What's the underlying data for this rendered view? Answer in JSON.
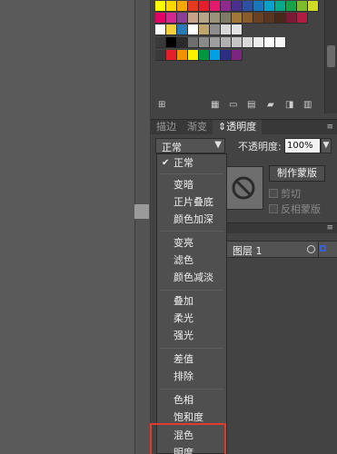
{
  "swatches": {
    "rows": [
      [
        "#fffc00",
        "#ffd800",
        "#f7a800",
        "#e63a1e",
        "#e41f2c",
        "#e31b6e",
        "#8e2a8e",
        "#4b2f8c",
        "#2f4fa0",
        "#1b75bb",
        "#0aa0c9",
        "#0aa88a",
        "#1aa24a",
        "#7dbd2d",
        "#cedb29"
      ],
      [
        "#e30065",
        "#d1298e",
        "#8a3e96",
        "#c7a38a",
        "#b7a68a",
        "#9a9379",
        "#7e7b68",
        "#a0783a",
        "#8a5d2a",
        "#6a4121",
        "#5a3622",
        "#47281b",
        "#7a1a33",
        "#b11c42"
      ],
      [
        "#ffffff",
        "#f4d03c",
        "#2a7ab8",
        "#ffffff",
        "#c0a56f",
        "#8e8e8e",
        "#d8d8d8",
        "#e3e3e3"
      ],
      [
        "#3a3a3a",
        "#000000",
        "#2b2b2b",
        "#6f6f6f",
        "#8a8a8a",
        "#9e9e9e",
        "#b1b1b1",
        "#c5c5c5",
        "#d9d9d9",
        "#ececec",
        "#ffffff",
        "#f7f7f7"
      ],
      [
        "#3a3a3a",
        "#e41f2c",
        "#f39200",
        "#fff200",
        "#009640",
        "#00a0e3",
        "#2d2e83",
        "#7b2481"
      ]
    ]
  },
  "tabs": [
    "描边",
    "渐变",
    "透明度"
  ],
  "transparency": {
    "blend_mode": "正常",
    "opacity_label": "不透明度:",
    "opacity_value": "100%",
    "make_mask": "制作蒙版",
    "clip": "剪切",
    "invert_mask": "反相蒙版"
  },
  "layers": {
    "layer_name": "图层 1"
  },
  "blend_menu": {
    "items": [
      "正常",
      "变暗",
      "正片叠底",
      "颜色加深",
      "变亮",
      "滤色",
      "颜色减淡",
      "叠加",
      "柔光",
      "强光",
      "差值",
      "排除",
      "色相",
      "饱和度",
      "混色",
      "明度"
    ],
    "selected": "正常",
    "highlighted": "混色"
  },
  "colors": {
    "highlight": "#e23b2e",
    "layer_selection": "#3d5ecf"
  }
}
